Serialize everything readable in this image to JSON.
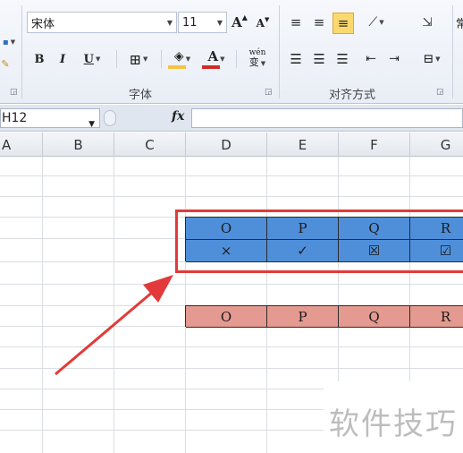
{
  "ribbon": {
    "font_name": "宋体",
    "font_size": "11",
    "grow_font_label": "A",
    "shrink_font_label": "A",
    "bold_label": "B",
    "italic_label": "I",
    "underline_label": "U",
    "phonetic_label": "wén",
    "font_group_label": "字体",
    "align_group_label": "对齐方式",
    "partial_label": "常",
    "fill_color": "#f5c242",
    "font_color": "#d42a2a"
  },
  "formula_bar": {
    "name_box": "H12",
    "fx_label": "fx",
    "formula": ""
  },
  "sheet": {
    "columns": [
      "A",
      "B",
      "C",
      "D",
      "E",
      "F",
      "G"
    ],
    "blue_row1": [
      "O",
      "P",
      "Q",
      "R"
    ],
    "blue_row2": [
      "×",
      "✓",
      "☒",
      "☑"
    ],
    "pink_row": [
      "O",
      "P",
      "Q",
      "R"
    ]
  },
  "watermark": "软件技巧",
  "colors": {
    "blue_fill": "#4f8fd9",
    "pink_fill": "#e49a90",
    "highlight": "#e23a3a"
  }
}
